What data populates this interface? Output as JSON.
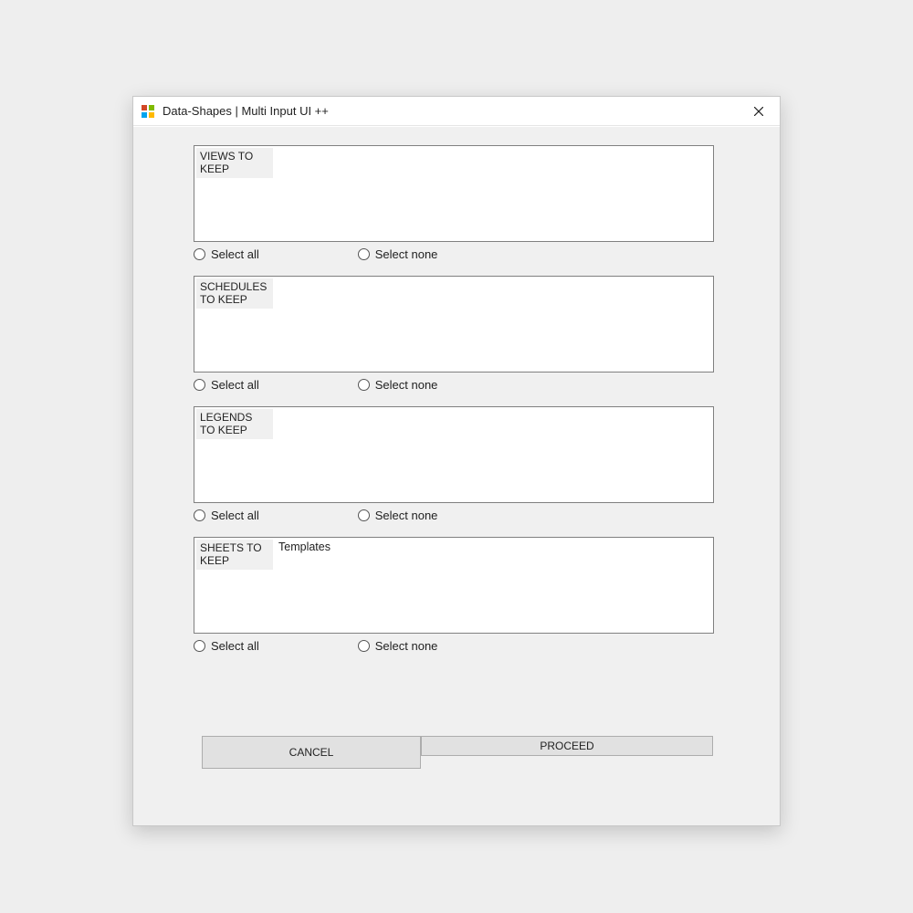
{
  "window": {
    "title": "Data-Shapes | Multi Input UI ++"
  },
  "sections": {
    "views": {
      "label": "VIEWS TO KEEP",
      "content": ""
    },
    "schedules": {
      "label": "SCHEDULES TO KEEP",
      "content": ""
    },
    "legends": {
      "label": "LEGENDS  TO KEEP",
      "content": ""
    },
    "sheets": {
      "label": "SHEETS TO KEEP",
      "content": "Templates"
    }
  },
  "radio": {
    "select_all": "Select all",
    "select_none": "Select none"
  },
  "buttons": {
    "cancel": "CANCEL",
    "proceed": "PROCEED"
  }
}
